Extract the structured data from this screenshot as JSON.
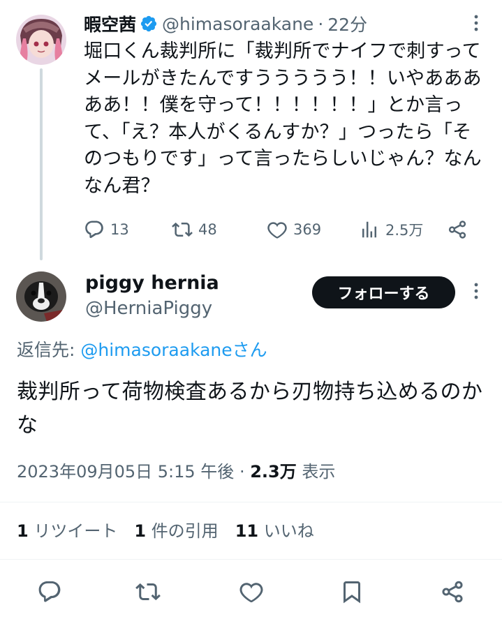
{
  "parent_tweet": {
    "author_name": "暇空茜",
    "handle": "@himasoraakane",
    "dot": "·",
    "time": "22分",
    "text": "堀口くん裁判所に「裁判所でナイフで刺すってメールがきたんですううううう！！いやあああああ！！僕を守って！！！！！！」とか言って、「え？本人がくるんすか？」つったら「そのつもりです」って言ったらしいじゃん？なんなん君？",
    "replies": "13",
    "retweets": "48",
    "likes": "369",
    "views": "2.5万"
  },
  "main_tweet": {
    "author_name": "piggy hernia",
    "handle": "@HerniaPiggy",
    "follow_label": "フォローする",
    "reply_to_prefix": "返信先: ",
    "reply_to_handle": "@himasoraakaneさん",
    "text": "裁判所って荷物検査あるから刃物持ち込めるのかな",
    "timestamp": "2023年09月05日 5:15 午後",
    "dot": "·",
    "views_count": "2.3万",
    "views_label": "表示"
  },
  "stats": {
    "retweets_count": "1",
    "retweets_label": "リツイート",
    "quotes_count": "1",
    "quotes_label": "件の引用",
    "likes_count": "11",
    "likes_label": "いいね"
  },
  "colors": {
    "accent": "#1d9bf0",
    "muted": "#536471",
    "text": "#0f1419",
    "verified": "#1d9bf0"
  }
}
